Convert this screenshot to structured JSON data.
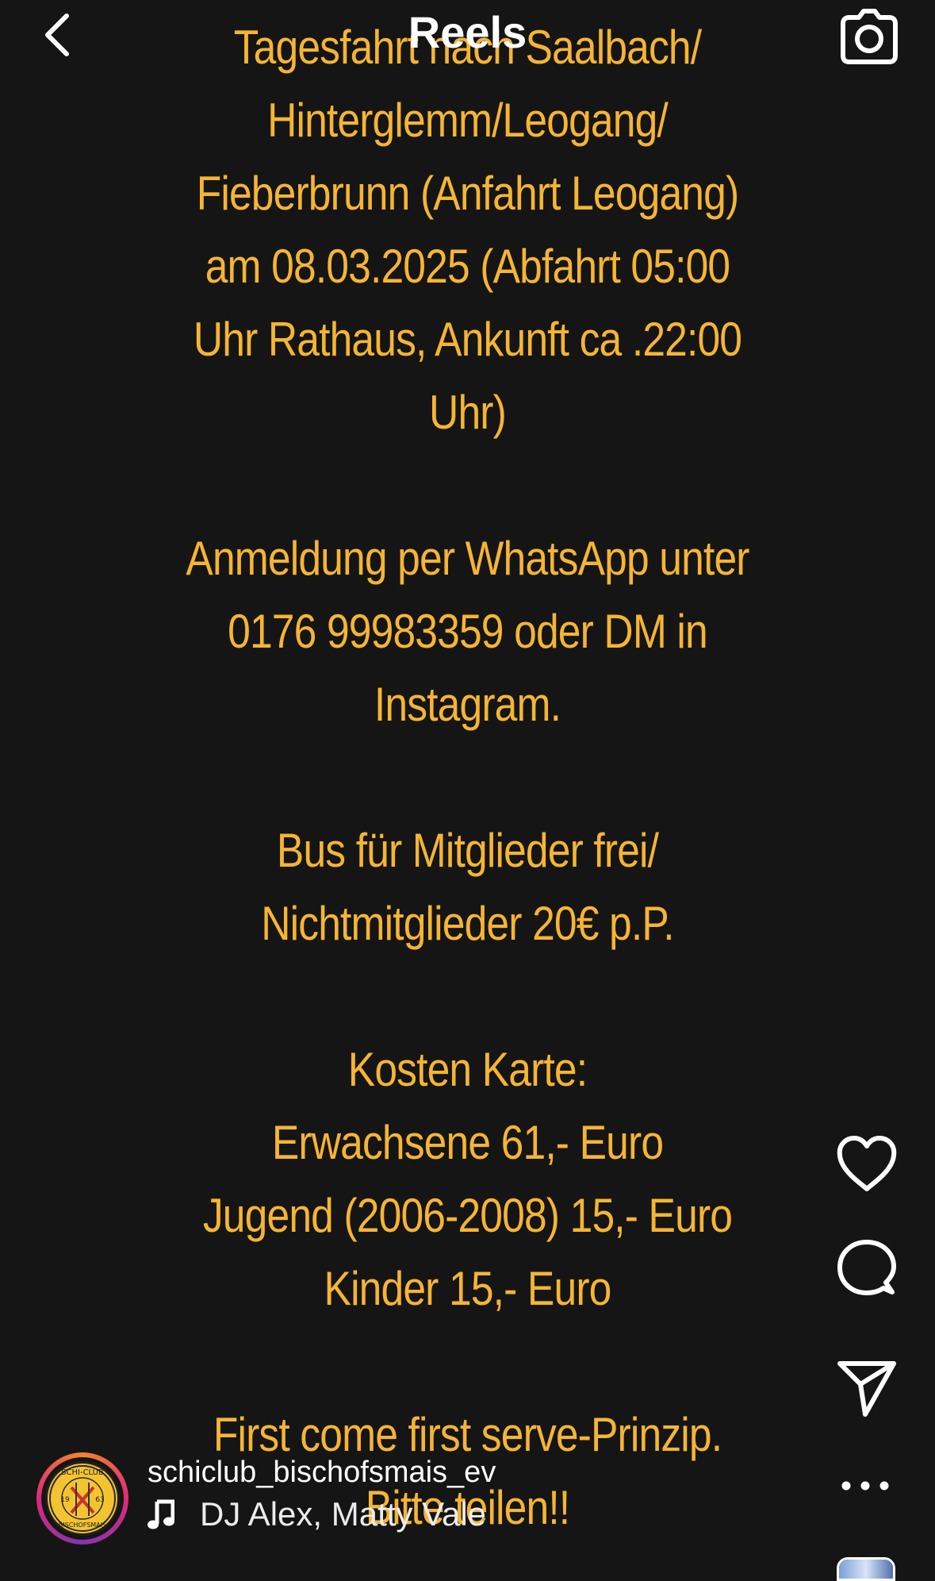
{
  "header": {
    "title": "Reels",
    "back_icon": "chevron-left-icon",
    "camera_icon": "camera-icon"
  },
  "video_text": {
    "lines": [
      "Tagesfahrt nach Saalbach/",
      "Hinterglemm/Leogang/",
      "Fieberbrunn (Anfahrt Leogang)",
      "am 08.03.2025 (Abfahrt 05:00",
      "Uhr Rathaus, Ankunft ca .22:00",
      "Uhr)",
      "",
      "Anmeldung per WhatsApp unter",
      "0176 99983359 oder DM in",
      "Instagram.",
      "",
      "Bus für Mitglieder frei/",
      "Nichtmitglieder 20€ p.P.",
      "",
      "Kosten Karte:",
      "Erwachsene 61,- Euro",
      "Jugend (2006-2008) 15,- Euro",
      "Kinder 15,- Euro",
      "",
      "First come first serve-Prinzip.",
      "Bitte teilen!!"
    ],
    "color": "#f5b533"
  },
  "actions": {
    "like_icon": "heart-icon",
    "comment_icon": "comment-icon",
    "share_icon": "send-icon",
    "more_icon": "more-horizontal-icon"
  },
  "author": {
    "username": "schiclub_bischofsmais_ev",
    "logo_text_top": "SCHI-CLUB",
    "logo_year_left": "19",
    "logo_year_right": "63",
    "logo_text_bottom": "BISCHOFSMAIS"
  },
  "audio": {
    "icon": "music-note-icon",
    "label": "DJ Alex, Matty Vale"
  }
}
